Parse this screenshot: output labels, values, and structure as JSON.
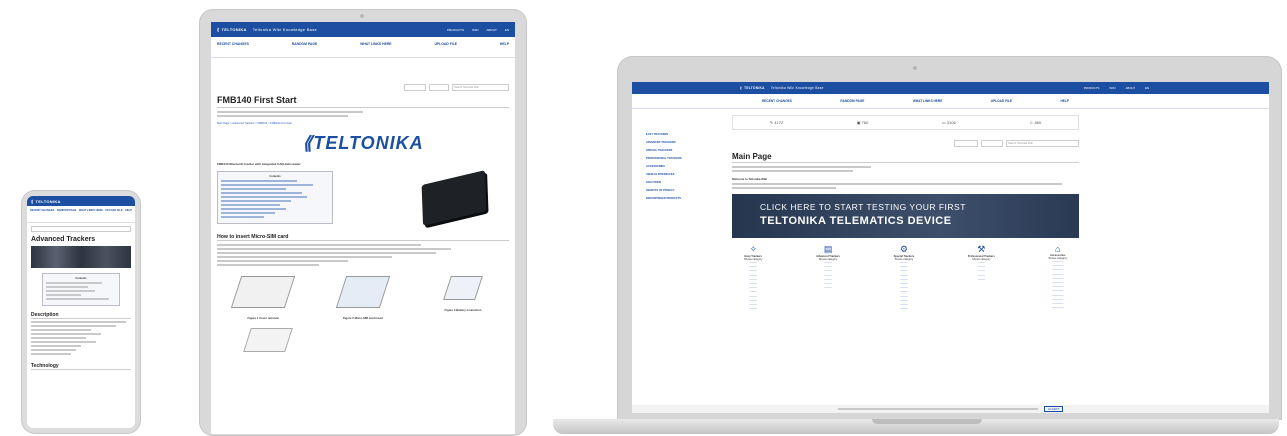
{
  "brand": {
    "name": "TELTONIKA",
    "site": "Teltonika Wiki Knowledge Base"
  },
  "header_links": [
    "PRODUCTS",
    "WIKI",
    "ABOUT",
    "EN"
  ],
  "nav": [
    "RECENT CHANGES",
    "RANDOM PAGE",
    "WHAT LINKS HERE",
    "UPLOAD FILE",
    "HELP"
  ],
  "phone": {
    "nav": [
      "RECENT CHANGES",
      "RANDOM PAGE",
      "WHAT LINKS HERE",
      "UPLOAD FILE",
      "HELP"
    ],
    "title": "Advanced Trackers",
    "contents_label": "Contents",
    "section_description": "Description",
    "section_technology": "Technology"
  },
  "tablet": {
    "search_placeholder": "Search Teltonika Wiki",
    "title": "FMB140 First Start",
    "breadcrumb": "Main Page > Advanced Trackers > FMB140 > FMB140 First Start",
    "logo_text": "TELTONIKA",
    "intro": "FMB140 Bluetooth tracker with integrated CAN data reader",
    "contents_label": "Contents",
    "section_heading": "How to insert Micro-SIM card",
    "figures": [
      "Figure 1 Cover removal",
      "Figure 2 Micro-SIM card insert",
      "Figure 3 Battery connection"
    ]
  },
  "laptop": {
    "sidebar": [
      "EASY TRACKERS",
      "ADVANCED TRACKERS",
      "SPECIAL TRACKERS",
      "PROFESSIONAL TRACKERS",
      "ACCESSORIES",
      "VEHICLE INTERFACES",
      "SOLUTIONS",
      "OBJECTS OF PRIVACY",
      "DISCONTINUED PRODUCTS"
    ],
    "stats": [
      "4172",
      "760",
      "3106",
      "869"
    ],
    "search_placeholder": "Search Teltonika Wiki",
    "title": "Main Page",
    "welcome": "Welcome to Teltonika Wiki",
    "banner_line1": "CLICK HERE TO START TESTING YOUR FIRST",
    "banner_line2": "TELTONIKA TELEMATICS DEVICE",
    "categories": [
      {
        "name": "Easy Trackers",
        "sub": "Shows category"
      },
      {
        "name": "Advanced Trackers",
        "sub": "Shows category"
      },
      {
        "name": "Special Trackers",
        "sub": "Shows category"
      },
      {
        "name": "Professional Trackers",
        "sub": "Shows category"
      },
      {
        "name": "Accessories",
        "sub": "Shows category"
      }
    ],
    "cookie_button": "ACCEPT"
  },
  "colors": {
    "brand_blue": "#1c4fa1",
    "banner": "#2c3e58"
  }
}
